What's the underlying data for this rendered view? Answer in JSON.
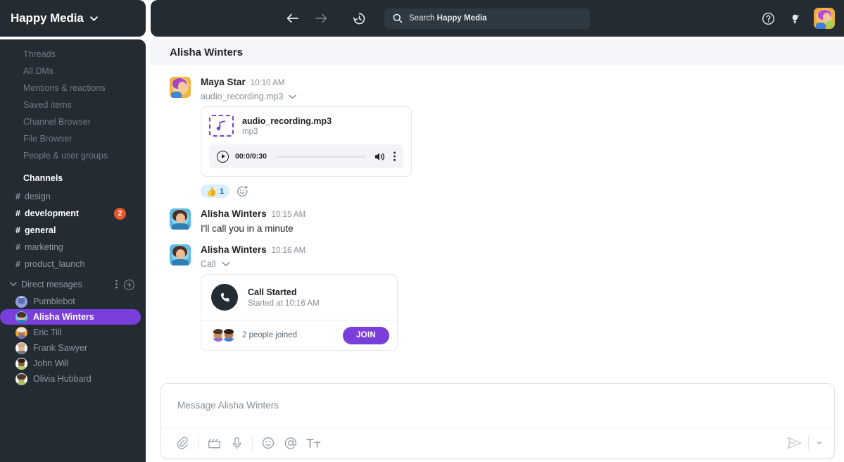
{
  "workspace": {
    "name": "Happy Media",
    "caret": "chevron-down-icon"
  },
  "sidebar": {
    "nav_items": [
      {
        "label": "Threads"
      },
      {
        "label": "All DMs"
      },
      {
        "label": "Mentions & reactions"
      },
      {
        "label": "Saved items"
      },
      {
        "label": "Channel Browser"
      },
      {
        "label": "File Browser"
      },
      {
        "label": "People & user groups"
      }
    ],
    "channels_label": "Channels",
    "channels": [
      {
        "name": "design",
        "unread": false,
        "badge": ""
      },
      {
        "name": "development",
        "unread": true,
        "badge": "2"
      },
      {
        "name": "general",
        "unread": true,
        "badge": ""
      },
      {
        "name": "marketing",
        "unread": false,
        "badge": ""
      },
      {
        "name": "product_launch",
        "unread": false,
        "badge": ""
      }
    ],
    "dm_section": {
      "label": "Direct mesages",
      "more_icon": "kebab-menu-icon",
      "add_icon": "plus-circle-icon"
    },
    "dms": [
      {
        "name": "Pumblebot",
        "active": false,
        "avatar_color": "#cbd3e8",
        "hair": "#9aa7d4"
      },
      {
        "name": "Alisha Winters",
        "active": true,
        "avatar_color": "#6fc3ec",
        "hair": "#3a2a22"
      },
      {
        "name": "Eric Till",
        "active": false,
        "avatar_color": "#f0a93c",
        "hair": "#e8e2d8"
      },
      {
        "name": "Frank Sawyer",
        "active": false,
        "avatar_color": "#ffffff",
        "hair": "#c9a88c"
      },
      {
        "name": "John Will",
        "active": false,
        "avatar_color": "#ffffff",
        "hair": "#2e2018"
      },
      {
        "name": "Olivia Hubbard",
        "active": false,
        "avatar_color": "#ffffff",
        "hair": "#4b3a2c"
      }
    ]
  },
  "topbar": {
    "back_icon": "arrow-left-icon",
    "forward_icon": "arrow-right-icon",
    "history_icon": "clock-history-icon",
    "search": {
      "icon": "search-icon",
      "prefix": "Search ",
      "workspace": "Happy Media"
    },
    "help_icon": "help-circle-icon",
    "ideas_icon": "lightbulb-icon",
    "avatar": "user-avatar",
    "status": "online"
  },
  "conversation": {
    "title": "Alisha Winters"
  },
  "messages": [
    {
      "author": "Maya Star",
      "time": "10:10 AM",
      "attachment_label": "audio_recording.mp3",
      "attachment_caret": "chevron-down-icon",
      "audio": {
        "file_name": "audio_recording.mp3",
        "file_type": "mp3",
        "icon": "music-note-icon",
        "play_icon": "play-circle-icon",
        "time": "00:0/0:30",
        "volume_icon": "volume-icon",
        "more_icon": "kebab-menu-icon",
        "progress": 0
      },
      "reactions": [
        {
          "emoji": "👍",
          "count": "1"
        }
      ],
      "add_reaction_icon": "add-reaction-icon"
    },
    {
      "author": "Alisha Winters",
      "time": "10:15 AM",
      "text": "I'll call you in a minute"
    },
    {
      "author": "Alisha Winters",
      "time": "10:16 AM",
      "attachment_label": "Call",
      "attachment_caret": "chevron-down-icon",
      "call": {
        "icon": "phone-icon",
        "title": "Call Started",
        "subtitle": "Started at 10:16 AM",
        "joined_text": "2 people joined",
        "join_label": "JOIN",
        "participants": 2
      }
    }
  ],
  "composer": {
    "placeholder": "Message Alisha Winters",
    "tools": [
      {
        "icon": "attachment-icon",
        "name": "attach-file"
      },
      {
        "icon": "video-clip-icon",
        "name": "record-video"
      },
      {
        "icon": "microphone-icon",
        "name": "record-audio"
      },
      {
        "icon": "emoji-icon",
        "name": "insert-emoji"
      },
      {
        "icon": "mention-icon",
        "name": "mention-someone"
      },
      {
        "icon": "text-format-icon",
        "name": "format-text"
      }
    ],
    "send_icon": "send-icon",
    "send_options_icon": "chevron-down-icon"
  },
  "colors": {
    "sidebar_bg": "#232b33",
    "accent_purple": "#7a3fdb",
    "badge_orange": "#e8562a",
    "reaction_blue": "#d9effc",
    "header_bg": "#f4f6f9"
  }
}
